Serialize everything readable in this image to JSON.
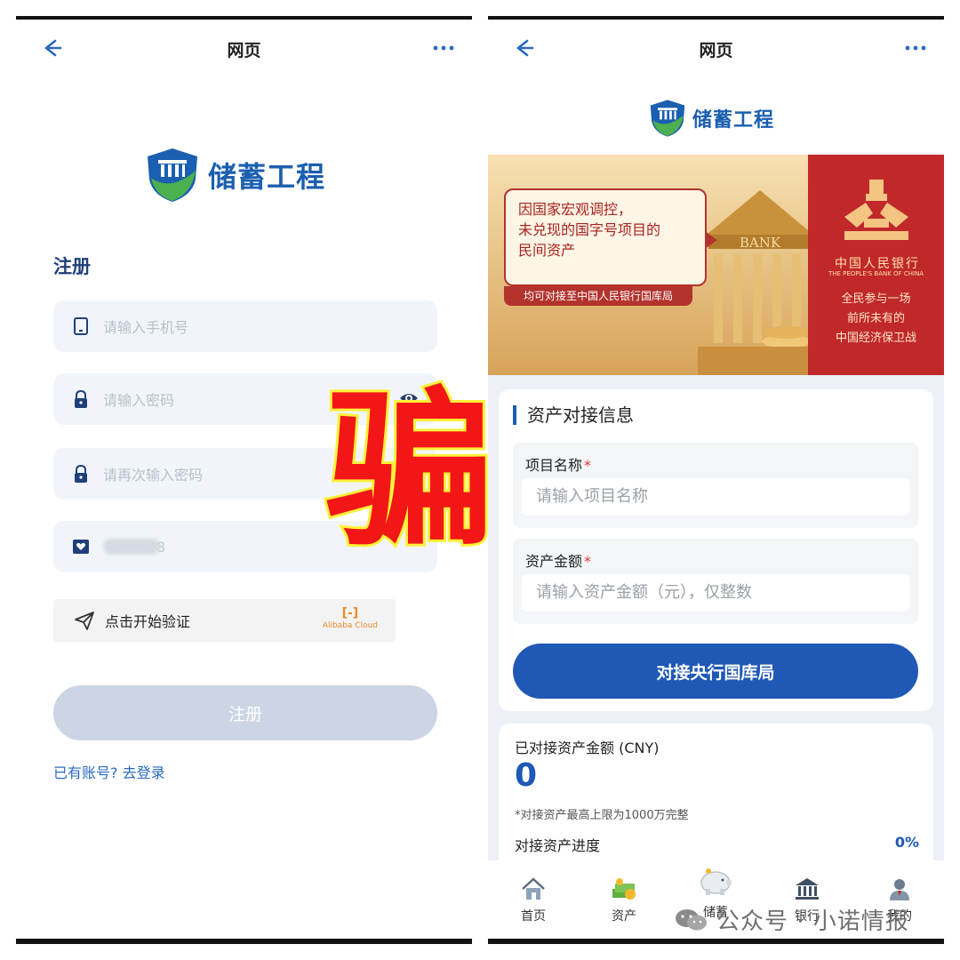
{
  "left": {
    "nav": {
      "title": "网页"
    },
    "logo_text": "储蓄工程",
    "register_title": "注册",
    "phone_placeholder": "请输入手机号",
    "password_placeholder": "请输入密码",
    "confirm_placeholder": "请再次输入密码",
    "invite_code_tail": "8",
    "verify_label": "点击开始验证",
    "alibaba_mark": "[-]",
    "alibaba_text": "Alibaba Cloud",
    "register_button": "注册",
    "login_link": "已有账号? 去登录"
  },
  "overlay_word": "骗",
  "right": {
    "nav": {
      "title": "网页"
    },
    "logo_text": "储蓄工程",
    "banner": {
      "bubble_lines": [
        "因国家宏观调控，",
        "未兑现的国字号项目的",
        "民间资产"
      ],
      "sub": "均可对接至中国人民银行国库局",
      "bank_sign": "BANK",
      "pboc_cn": "中国人民银行",
      "pboc_en": "THE PEOPLE'S BANK OF CHINA",
      "slogan_lines": [
        "全民参与一场",
        "前所未有的",
        "中国经济保卫战"
      ]
    },
    "section_title": "资产对接信息",
    "project_label": "项目名称",
    "project_placeholder": "请输入项目名称",
    "amount_label": "资产金额",
    "amount_placeholder": "请输入资产金额（元），仅整数",
    "required_mark": "*",
    "connect_button": "对接央行国库局",
    "connected_label": "已对接资产金额 (CNY)",
    "connected_value": "0",
    "limit_note": "*对接资产最高上限为1000万完整",
    "progress_label": "对接资产进度",
    "progress_pct": "0%",
    "tabs": [
      {
        "label": "首页",
        "icon": "home-icon"
      },
      {
        "label": "资产",
        "icon": "money-stack-icon"
      },
      {
        "label": "储蓄",
        "icon": "piggy-bank-icon"
      },
      {
        "label": "银行",
        "icon": "bank-icon"
      },
      {
        "label": "我的",
        "icon": "user-icon"
      }
    ]
  },
  "watermark": "公众号 · 小诺情报",
  "colors": {
    "brand_blue": "#1f58b5",
    "banner_red": "#c0282a",
    "scam_red": "#f21616",
    "scam_outline": "#fff03a"
  }
}
